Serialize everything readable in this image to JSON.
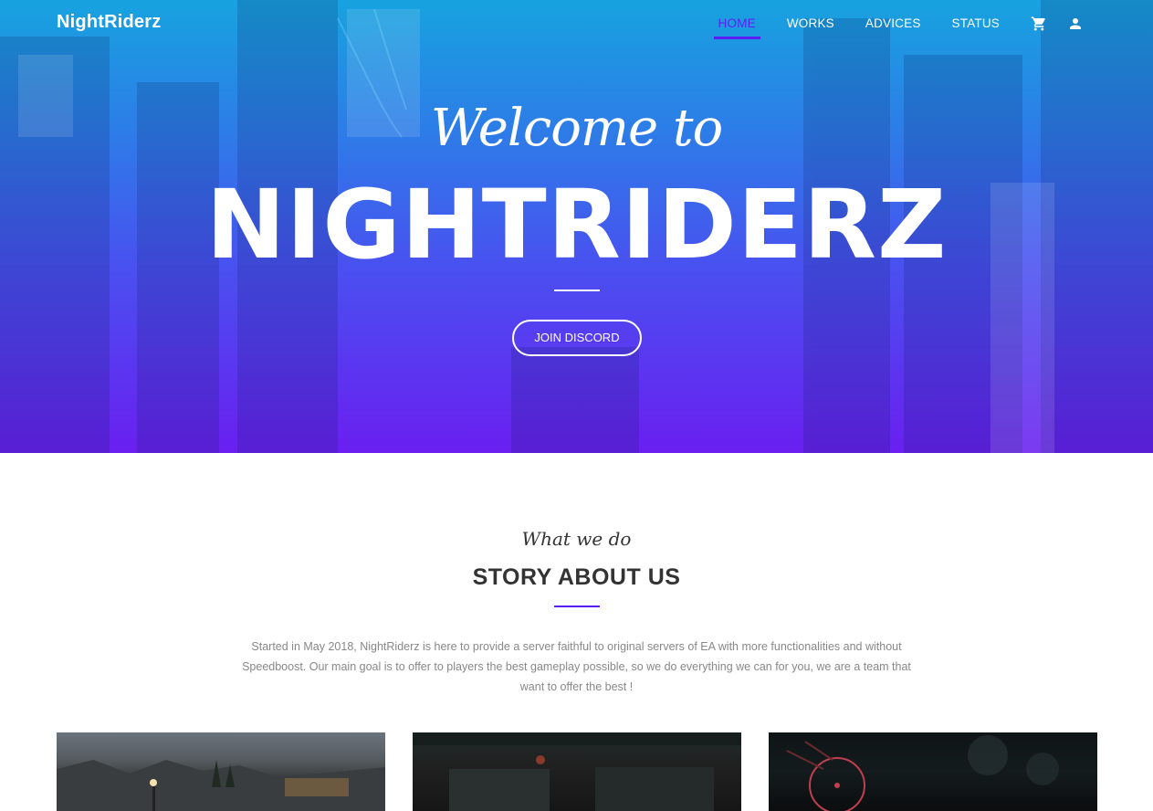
{
  "brand": "NightRiderz",
  "nav": {
    "items": [
      {
        "label": "HOME",
        "active": true
      },
      {
        "label": "WORKS",
        "active": false
      },
      {
        "label": "ADVICES",
        "active": false
      },
      {
        "label": "STATUS",
        "active": false
      }
    ],
    "icons": [
      "cart-icon",
      "user-icon"
    ],
    "active_color": "#5b1ff5"
  },
  "hero": {
    "welcome": "Welcome to",
    "title": "NIGHTRIDERZ",
    "button_label": "JOIN DISCORD",
    "gradient": [
      "#17a3df",
      "#6a1ff0"
    ]
  },
  "story": {
    "kicker": "What we do",
    "title": "STORY ABOUT US",
    "text": "Started in May 2018, NightRiderz is here to provide a server faithful to original servers of EA with more functionalities and without Speedboost. Our main goal is to offer to players the best gameplay possible, so we do everything we can for you, we are a team that want to offer the best !",
    "accent": "#5b1ff5"
  }
}
